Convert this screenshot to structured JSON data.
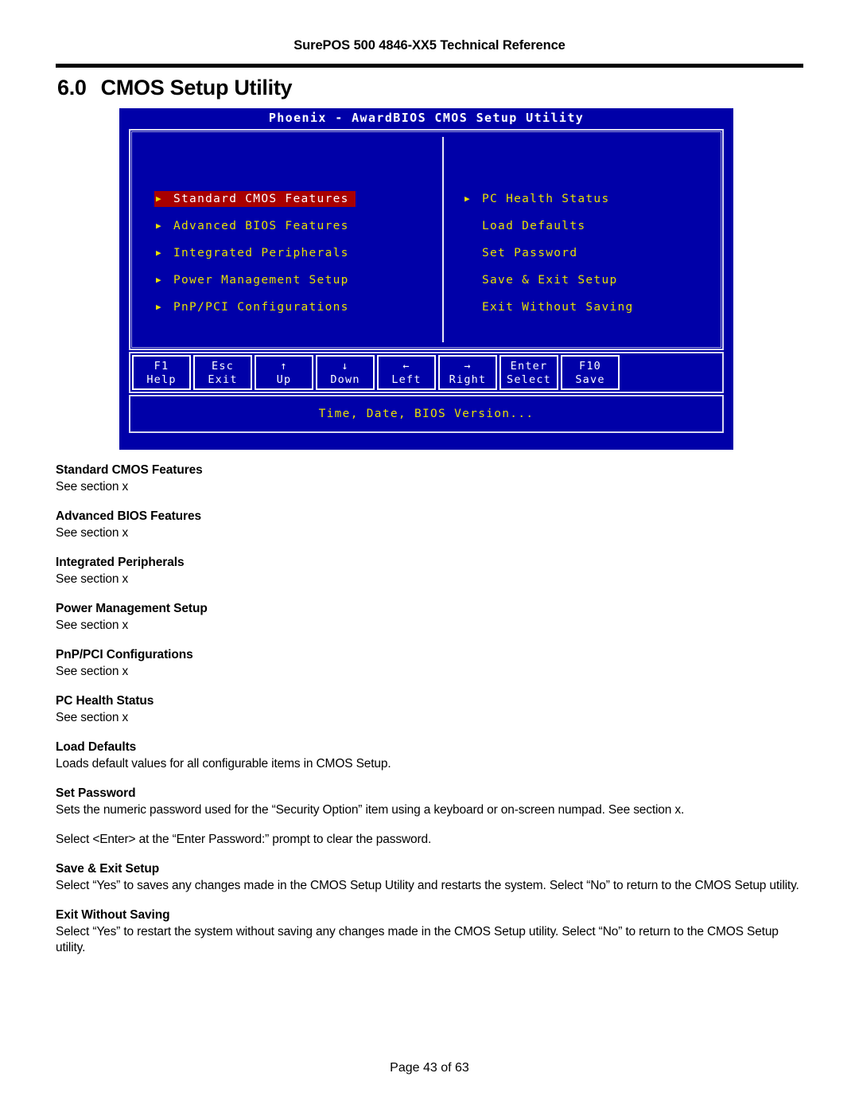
{
  "header": {
    "running_title": "SurePOS 500 4846-XX5 Technical Reference"
  },
  "section": {
    "number": "6.0",
    "title": "CMOS Setup Utility"
  },
  "bios": {
    "titlebar": "Phoenix - AwardBIOS CMOS Setup Utility",
    "left_menu": [
      {
        "label": "Standard CMOS Features",
        "arrow": "▶",
        "selected": true
      },
      {
        "label": "Advanced BIOS Features",
        "arrow": "▶",
        "selected": false
      },
      {
        "label": "Integrated Peripherals",
        "arrow": "▶",
        "selected": false
      },
      {
        "label": "Power Management Setup",
        "arrow": "▶",
        "selected": false
      },
      {
        "label": "PnP/PCI Configurations",
        "arrow": "▶",
        "selected": false
      }
    ],
    "right_menu": [
      {
        "label": "PC Health Status",
        "arrow": "▶",
        "selected": false
      },
      {
        "label": "Load Defaults",
        "arrow": "",
        "selected": false
      },
      {
        "label": "Set Password",
        "arrow": "",
        "selected": false
      },
      {
        "label": "Save & Exit Setup",
        "arrow": "",
        "selected": false
      },
      {
        "label": "Exit Without Saving",
        "arrow": "",
        "selected": false
      }
    ],
    "keys": [
      {
        "key": "F1",
        "action": "Help"
      },
      {
        "key": "Esc",
        "action": "Exit"
      },
      {
        "key": "↑",
        "action": "Up"
      },
      {
        "key": "↓",
        "action": "Down"
      },
      {
        "key": "←",
        "action": "Left"
      },
      {
        "key": "→",
        "action": "Right"
      },
      {
        "key": "Enter",
        "action": "Select"
      },
      {
        "key": "F10",
        "action": "Save"
      }
    ],
    "status_line": "Time, Date, BIOS Version...",
    "colors": {
      "background": "#0000a8",
      "menu_text": "#e8e000",
      "selected_background": "#a80000",
      "selected_text": "#ffffff",
      "border": "#d8d8f0",
      "title_text": "#ffffff"
    }
  },
  "entries": [
    {
      "heading": "Standard CMOS Features",
      "paragraphs": [
        "See section x"
      ]
    },
    {
      "heading": "Advanced BIOS Features",
      "paragraphs": [
        "See section x"
      ]
    },
    {
      "heading": "Integrated Peripherals",
      "paragraphs": [
        "See section x"
      ]
    },
    {
      "heading": "Power Management Setup",
      "paragraphs": [
        "See section x"
      ]
    },
    {
      "heading": "PnP/PCI Configurations",
      "paragraphs": [
        "See section x"
      ]
    },
    {
      "heading": "PC Health Status",
      "paragraphs": [
        "See section x"
      ]
    },
    {
      "heading": "Load Defaults",
      "paragraphs": [
        "Loads default values for all configurable items in CMOS Setup."
      ]
    },
    {
      "heading": "Set Password",
      "paragraphs": [
        "Sets the numeric password used for the “Security Option” item using a keyboard or on-screen numpad.  See section x.",
        "Select <Enter> at the “Enter Password:” prompt to clear the password."
      ]
    },
    {
      "heading": "Save & Exit Setup",
      "paragraphs": [
        "Select “Yes” to saves any changes made in the CMOS Setup Utility and restarts the system.  Select “No” to return to the CMOS Setup utility."
      ]
    },
    {
      "heading": "Exit Without Saving",
      "paragraphs": [
        "Select “Yes” to restart the system without saving any changes made in the CMOS Setup utility.  Select “No” to return to the CMOS Setup utility."
      ]
    }
  ],
  "footer": {
    "page_label": "Page 43 of 63"
  }
}
